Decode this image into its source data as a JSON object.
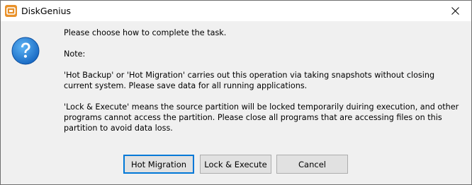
{
  "window": {
    "title": "DiskGenius",
    "icon": "diskgenius-app-icon",
    "close_icon": "close-icon"
  },
  "dialog": {
    "icon": "question-icon",
    "messages": [
      "Please choose how to complete the task.",
      "Note:",
      "'Hot Backup' or 'Hot Migration' carries out this operation via taking snapshots without closing current system. Please save data for all running applications.",
      "'Lock & Execute' means the source partition will be locked temporarily duiring execution, and other programs cannot access the partition. Please close all programs that are accessing files on this partition to avoid data loss."
    ]
  },
  "buttons": {
    "hot_migration": "Hot Migration",
    "lock_execute": "Lock & Execute",
    "cancel": "Cancel"
  },
  "colors": {
    "accent": "#0078d7",
    "question_icon": "#1e88e5",
    "app_icon": "#e8912a"
  }
}
